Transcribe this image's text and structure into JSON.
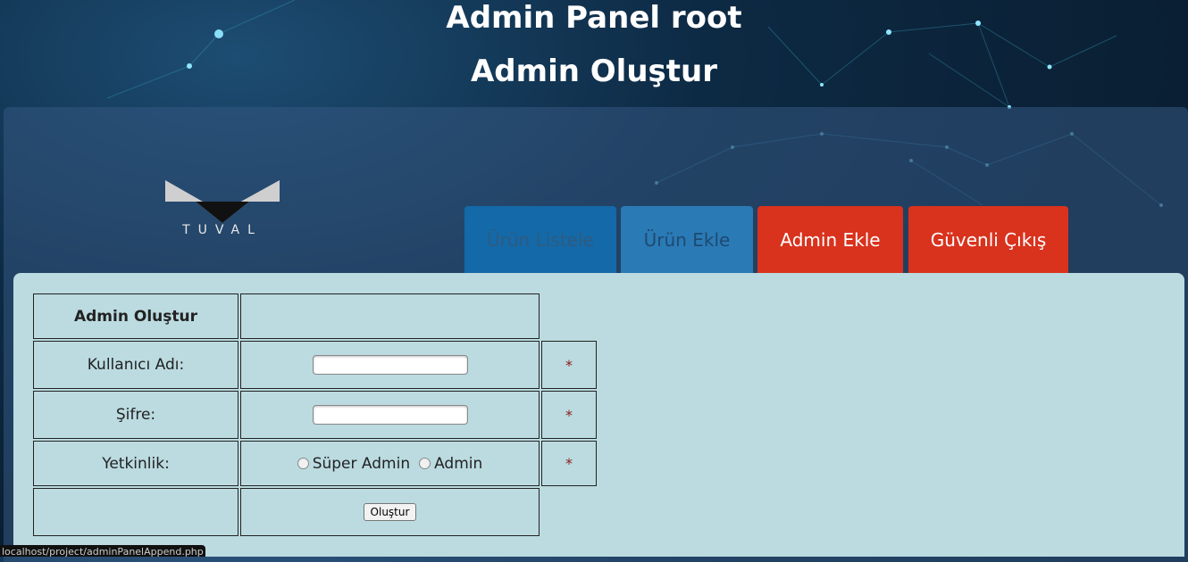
{
  "header": {
    "title": "Admin Panel root",
    "subtitle": "Admin Oluştur"
  },
  "logo": {
    "text": "TUVAL"
  },
  "nav": {
    "tabs": [
      {
        "label": "Ürün Listele"
      },
      {
        "label": "Ürün Ekle"
      },
      {
        "label": "Admin Ekle"
      },
      {
        "label": "Güvenli Çıkış"
      }
    ]
  },
  "form": {
    "heading": "Admin Oluştur",
    "username_label": "Kullanıcı Adı:",
    "username_value": "",
    "password_label": "Şifre:",
    "password_value": "",
    "role_label": "Yetkinlik:",
    "role_options": [
      "Süper Admin",
      "Admin"
    ],
    "required_mark": "*",
    "submit_label": "Oluştur"
  },
  "status_bar": {
    "url": "localhost/project/adminPanelAppend.php"
  },
  "colors": {
    "accent_red": "#d9321d",
    "tab_blue": "#1469a8",
    "content_bg": "#bbdbe0"
  }
}
